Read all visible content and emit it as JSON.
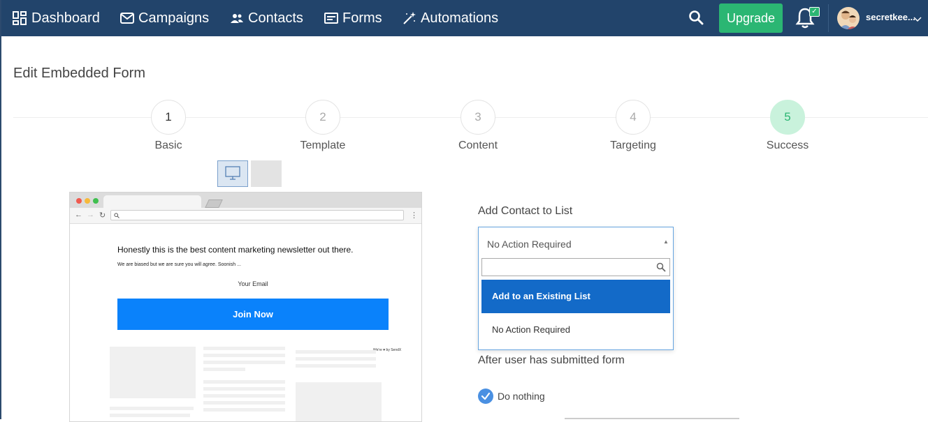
{
  "nav": {
    "items": [
      {
        "label": "Dashboard",
        "icon": "dashboard-icon"
      },
      {
        "label": "Campaigns",
        "icon": "envelope-icon"
      },
      {
        "label": "Contacts",
        "icon": "users-icon"
      },
      {
        "label": "Forms",
        "icon": "form-icon"
      },
      {
        "label": "Automations",
        "icon": "magic-wand-icon"
      }
    ],
    "upgrade_label": "Upgrade",
    "user_name": "secretkee...",
    "bell_badge": "✓"
  },
  "page": {
    "title": "Edit Embedded Form"
  },
  "stepper": {
    "steps": [
      {
        "number": "1",
        "label": "Basic"
      },
      {
        "number": "2",
        "label": "Template"
      },
      {
        "number": "3",
        "label": "Content"
      },
      {
        "number": "4",
        "label": "Targeting"
      },
      {
        "number": "5",
        "label": "Success"
      }
    ]
  },
  "preview": {
    "title": "Honestly this is the best content marketing newsletter out there.",
    "subtitle": "We are biased but we are sure you will agree. Soonish ...",
    "email_placeholder": "Your Email",
    "button_label": "Join Now",
    "powered_by": "We're ♥ by SendX"
  },
  "form": {
    "add_contact_label": "Add Contact to List",
    "selected_value": "No Action Required",
    "options": [
      "Add to an Existing List",
      "No Action Required"
    ],
    "after_submit_label": "After user has submitted form",
    "radio_label": "Do nothing"
  },
  "colors": {
    "nav_bg": "#22446b",
    "upgrade": "#2bb673",
    "highlight": "#136ac8",
    "join_button": "#0a82fb"
  }
}
